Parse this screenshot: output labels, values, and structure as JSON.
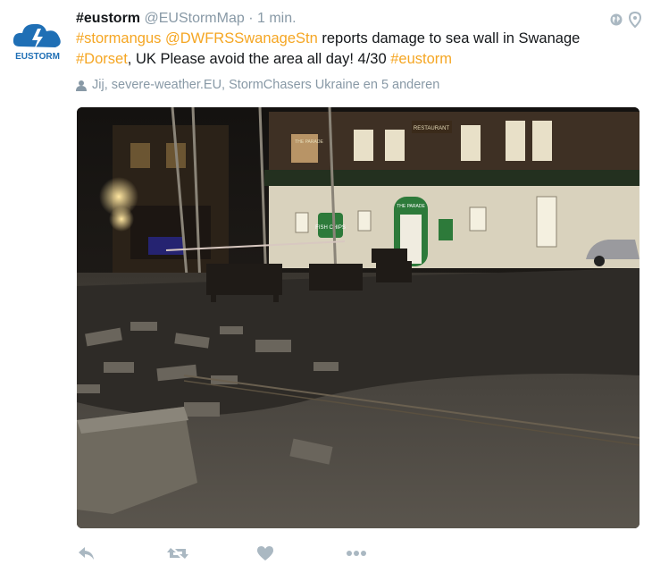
{
  "tweet": {
    "display_name": "#eustorm",
    "handle": "@EUStormMap",
    "separator": "·",
    "time": "1 min.",
    "text_parts": [
      {
        "text": "#stormangus",
        "type": "hashtag"
      },
      {
        "text": " ",
        "type": "plain"
      },
      {
        "text": "@DWFRSSwanageStn",
        "type": "mention"
      },
      {
        "text": " reports damage to sea wall in Swanage ",
        "type": "plain"
      },
      {
        "text": "#Dorset",
        "type": "hashtag"
      },
      {
        "text": ", UK Please avoid the area all day! 4/30 ",
        "type": "plain"
      },
      {
        "text": "#eustorm",
        "type": "hashtag"
      }
    ],
    "context_text": "Jij, severe-weather.EU, StormChasers Ukraine en 5 anderen",
    "accent_color": "#f5a623"
  },
  "avatar": {
    "logo_text": "EUSTORM",
    "icon": "cloud-lightning-logo"
  },
  "top_icons": [
    "globe-icon",
    "location-pin-icon"
  ],
  "photo": {
    "signs": [
      "THE PARADE",
      "RESTAURANT",
      "FISH CHIPS",
      "THE PARADE"
    ]
  },
  "actions": [
    {
      "name": "reply-button",
      "icon": "reply-icon"
    },
    {
      "name": "retweet-button",
      "icon": "retweet-icon"
    },
    {
      "name": "like-button",
      "icon": "heart-icon"
    },
    {
      "name": "more-button",
      "icon": "more-dots-icon"
    }
  ]
}
